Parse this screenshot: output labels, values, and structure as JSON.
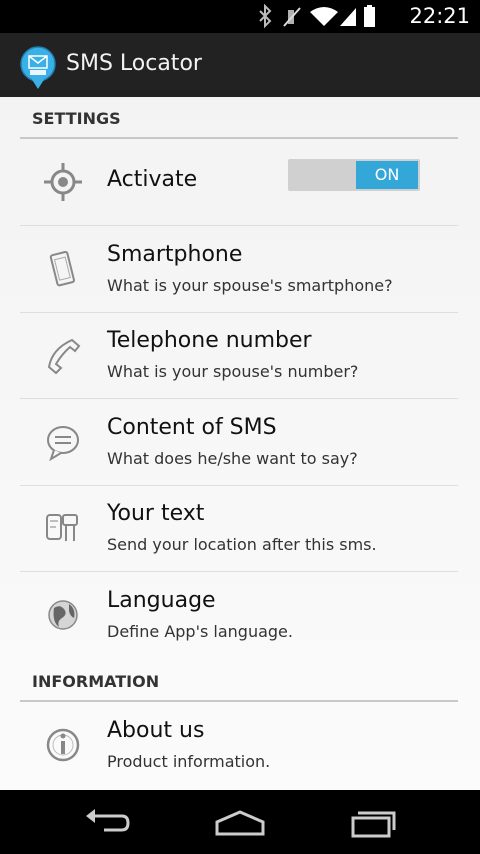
{
  "status_bar": {
    "time": "22:21"
  },
  "app": {
    "title": "SMS Locator",
    "icon": "sms-bubble-icon"
  },
  "sections": [
    {
      "header": "SETTINGS"
    },
    {
      "header": "INFORMATION"
    }
  ],
  "settings": {
    "activate": {
      "title": "Activate",
      "toggle_label": "ON",
      "state": "on"
    },
    "smartphone": {
      "title": "Smartphone",
      "summary": "What is your spouse's smartphone?"
    },
    "telephone": {
      "title": "Telephone number",
      "summary": "What is your spouse's number?"
    },
    "content_sms": {
      "title": "Content of SMS",
      "summary": "What does he/she want to say?"
    },
    "your_text": {
      "title": "Your text",
      "summary": "Send your location after this sms."
    },
    "language": {
      "title": "Language",
      "summary": "Define App's language."
    }
  },
  "information": {
    "about": {
      "title": "About us",
      "summary": "Product information."
    }
  },
  "colors": {
    "accent": "#33a8d8",
    "actionbar": "#222222"
  }
}
